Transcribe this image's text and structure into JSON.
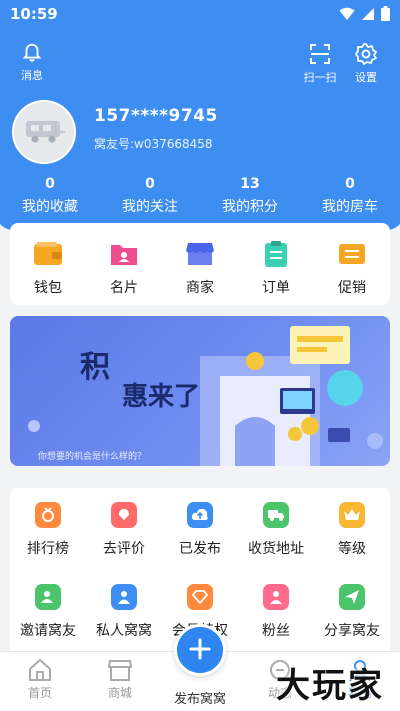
{
  "status": {
    "time": "10:59"
  },
  "header": {
    "message_label": "消息",
    "scan_label": "扫一扫",
    "settings_label": "设置"
  },
  "user": {
    "phone": "157****9745",
    "id_text": "窝友号:w037668458"
  },
  "stats": [
    {
      "value": "0",
      "label": "我的收藏"
    },
    {
      "value": "0",
      "label": "我的关注"
    },
    {
      "value": "13",
      "label": "我的积分"
    },
    {
      "value": "0",
      "label": "我的房车"
    }
  ],
  "quick_actions": [
    {
      "label": "钱包",
      "icon": "wallet-icon",
      "color": "#f5a623"
    },
    {
      "label": "名片",
      "icon": "card-icon",
      "color": "#ee4d8f"
    },
    {
      "label": "商家",
      "icon": "shop-icon",
      "color": "#4a63e8"
    },
    {
      "label": "订单",
      "icon": "order-icon",
      "color": "#3ccfb3"
    },
    {
      "label": "促销",
      "icon": "promo-icon",
      "color": "#f5a623"
    }
  ],
  "banner": {
    "title1": "积",
    "title2": "惠来了",
    "subtitle": "你想要的机会是什么样的？"
  },
  "grid_row1": [
    {
      "label": "排行榜",
      "icon": "medal-icon",
      "color": "#ff8a3d"
    },
    {
      "label": "去评价",
      "icon": "rate-icon",
      "color": "#ff6b6b"
    },
    {
      "label": "已发布",
      "icon": "cloud-upload-icon",
      "color": "#3d8ef0"
    },
    {
      "label": "收货地址",
      "icon": "truck-icon",
      "color": "#4cc46b"
    },
    {
      "label": "等级",
      "icon": "crown-icon",
      "color": "#f7b733"
    }
  ],
  "grid_row2": [
    {
      "label": "邀请窝友",
      "icon": "invite-icon",
      "color": "#4cc46b"
    },
    {
      "label": "私人窝窝",
      "icon": "private-icon",
      "color": "#3d8ef0"
    },
    {
      "label": "会员特权",
      "icon": "diamond-icon",
      "color": "#ff8a3d"
    },
    {
      "label": "粉丝",
      "icon": "fans-icon",
      "color": "#ff6b8a"
    },
    {
      "label": "分享窝友",
      "icon": "share-icon",
      "color": "#4cc46b"
    }
  ],
  "tabs": [
    {
      "label": "首页",
      "icon": "home-icon"
    },
    {
      "label": "商城",
      "icon": "store-icon"
    },
    {
      "label": "发布窝窝",
      "icon": "plus-icon"
    },
    {
      "label": "动态",
      "icon": "feed-icon"
    },
    {
      "label": "我的",
      "icon": "profile-icon"
    }
  ],
  "watermark": "大玩家",
  "colors": {
    "primary": "#3d8ef0",
    "background": "#f2f3f5"
  }
}
